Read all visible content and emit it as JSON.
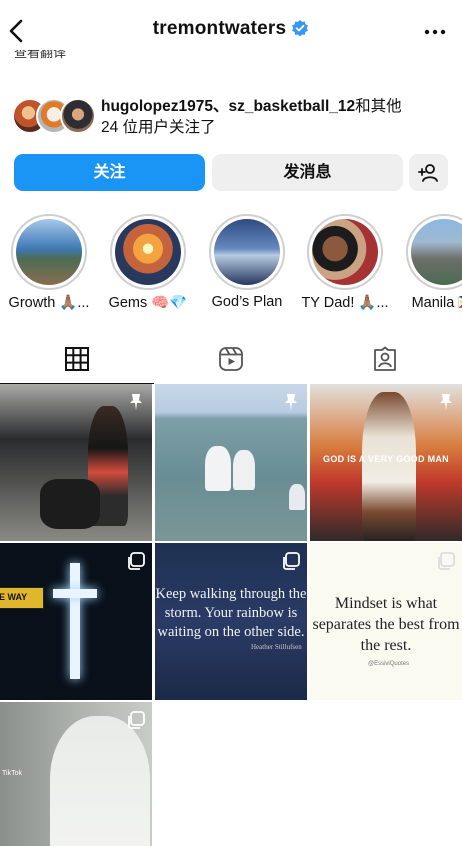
{
  "header": {
    "username": "tremontwaters",
    "back_icon": "chevron-left-icon",
    "verified_icon": "verified-badge-icon",
    "more_icon": "more-horizontal-icon",
    "cut_text": "查看翻译"
  },
  "followed_by": {
    "names": "hugolopez1975、sz_basketball_12",
    "suffix": "和其他",
    "line2": "24 位用户关注了"
  },
  "buttons": {
    "follow": "关注",
    "message": "发消息",
    "add_user_icon": "add-person-icon"
  },
  "highlights": [
    {
      "label": "Growth 🙏🏽..."
    },
    {
      "label": "Gems 🧠💎"
    },
    {
      "label": "God’s Plan"
    },
    {
      "label": "TY Dad! 🙏🏽..."
    },
    {
      "label": "Manila 🇵🇭"
    }
  ],
  "tabs": [
    {
      "name": "posts",
      "icon": "grid-icon",
      "active": true
    },
    {
      "name": "reels",
      "icon": "reels-icon",
      "active": false
    },
    {
      "name": "tagged",
      "icon": "tagged-person-icon",
      "active": false
    }
  ],
  "posts": {
    "p3_caption": "GOD IS A VERY GOOD MAN",
    "p4_sign": "E WAY",
    "p5_quote": "Keep walking through the storm. Your rainbow is waiting on the other side.",
    "p5_author": "Heather Stillufsen",
    "p6_quote": "Mindset is what separates the best from the rest.",
    "p6_handle": "@EssiviQuotes",
    "p7_watermark": "TikTok"
  },
  "colors": {
    "primary_button": "#1a95f6",
    "secondary_button": "#efefef",
    "verified": "#3897f0"
  }
}
